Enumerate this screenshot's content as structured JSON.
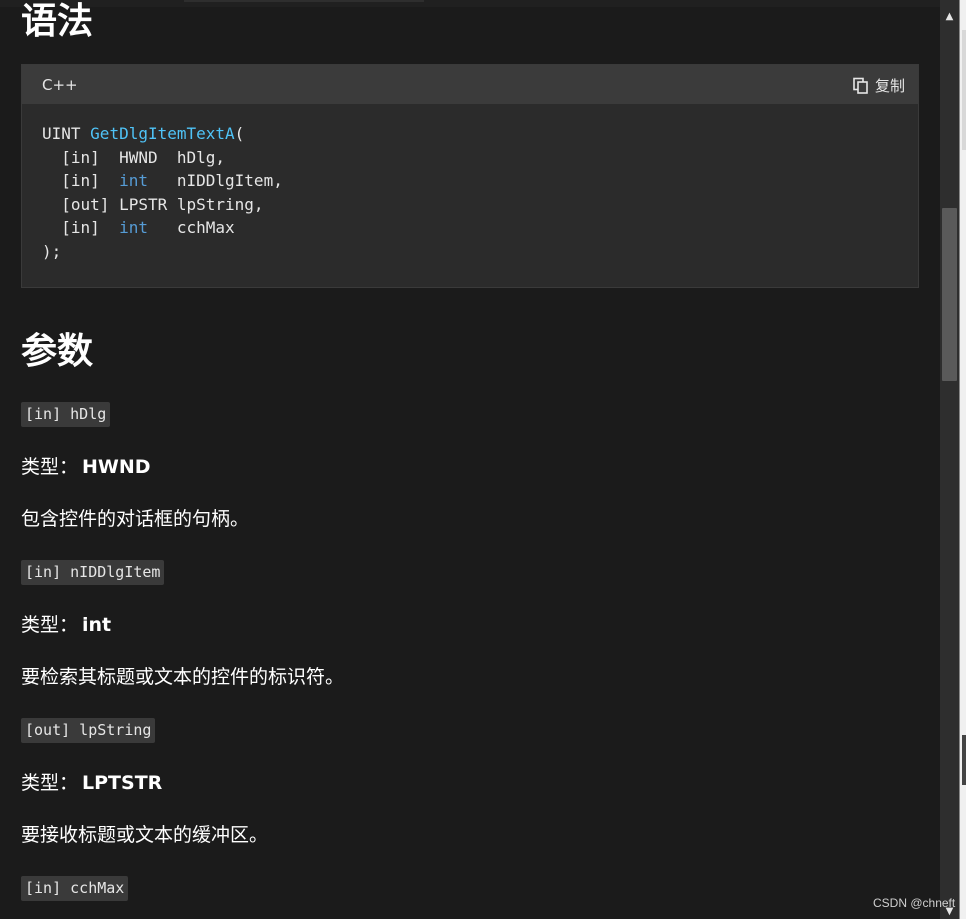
{
  "sections": {
    "syntax_title": "语法",
    "params_title": "参数"
  },
  "code_block": {
    "language": "C++",
    "copy_label": "复制",
    "copy_icon": "copy-icon",
    "lines": [
      {
        "pre": "UINT ",
        "fn": "GetDlgItemTextA",
        "post": "("
      },
      {
        "pre": "  [in]  HWND  hDlg,"
      },
      {
        "pre": "  [in]  ",
        "kw": "int",
        "post": "   nIDDlgItem,"
      },
      {
        "pre": "  [out] LPSTR lpString,"
      },
      {
        "pre": "  [in]  ",
        "kw": "int",
        "post": "   cchMax"
      },
      {
        "pre": ");"
      }
    ]
  },
  "params": [
    {
      "name": "[in] hDlg",
      "type_label": "类型：",
      "type": "HWND",
      "desc": "包含控件的对话框的句柄。"
    },
    {
      "name": "[in] nIDDlgItem",
      "type_label": "类型：",
      "type": "int",
      "desc": "要检索其标题或文本的控件的标识符。"
    },
    {
      "name": "[out] lpString",
      "type_label": "类型：",
      "type": "LPTSTR",
      "desc": "要接收标题或文本的缓冲区。"
    },
    {
      "name": "[in] cchMax"
    }
  ],
  "watermark": "CSDN @chneft",
  "colors": {
    "background": "#1b1b1b",
    "code_bg": "#2b2b2b",
    "code_header_bg": "#3b3b3b",
    "function_name": "#4fc3f7",
    "keyword": "#569cd6"
  }
}
